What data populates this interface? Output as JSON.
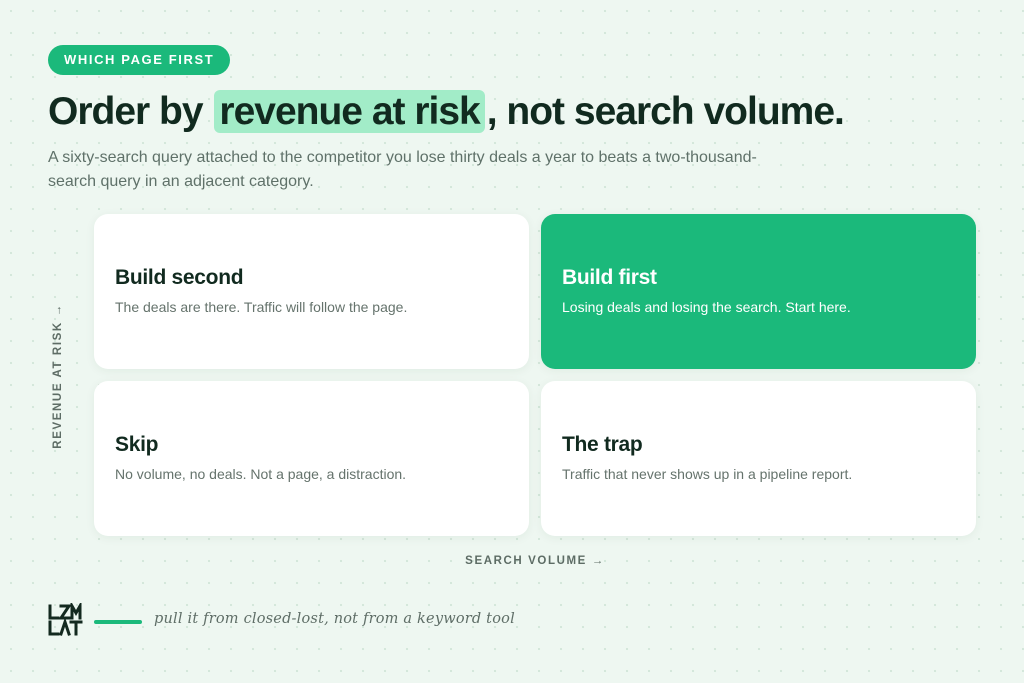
{
  "badge": {
    "label": "WHICH PAGE FIRST"
  },
  "headline": {
    "before": "Order by",
    "highlight": "revenue at risk",
    "after": ", not search volume."
  },
  "subhead": "A sixty-search query attached to the competitor you lose thirty deals a year to beats a two-thousand-search query in an adjacent category.",
  "axes": {
    "y_label": "REVENUE AT RISK →",
    "x_label": "SEARCH VOLUME →"
  },
  "quadrants": [
    {
      "title": "Build second",
      "text": "The deals are there. Traffic will follow the page."
    },
    {
      "title": "Build first",
      "text": "Losing deals and losing the search. Start here."
    },
    {
      "title": "Skip",
      "text": "No volume, no deals. Not a page, a distraction."
    },
    {
      "title": "The trap",
      "text": "Traffic that never shows up in a pipeline report."
    }
  ],
  "footer": {
    "logo_icon": "brand-logo-icon",
    "note": "pull it from closed-lost, not from a keyword tool"
  },
  "colors": {
    "accent": "#1bb97b",
    "highlight": "#a2ecc8",
    "background": "#eef7f1",
    "ink": "#112a1f"
  }
}
